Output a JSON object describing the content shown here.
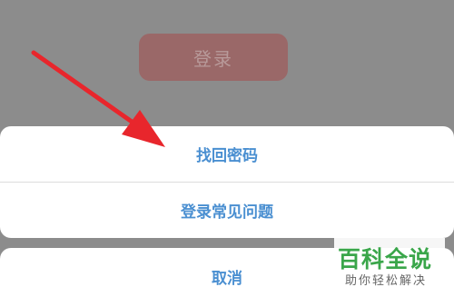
{
  "background": {
    "login_button_label": "登录"
  },
  "action_sheet": {
    "items": [
      {
        "label": "找回密码"
      },
      {
        "label": "登录常见问题"
      }
    ],
    "cancel_label": "取消"
  },
  "watermark": {
    "title": "百科全说",
    "subtitle": "助你轻松解决"
  },
  "colors": {
    "overlay": "#8c8c8c",
    "action_text": "#4a8fd1",
    "arrow": "#e8262c",
    "watermark_green": "#3aa64a"
  },
  "icons": {
    "annotation": "red-arrow-icon"
  }
}
